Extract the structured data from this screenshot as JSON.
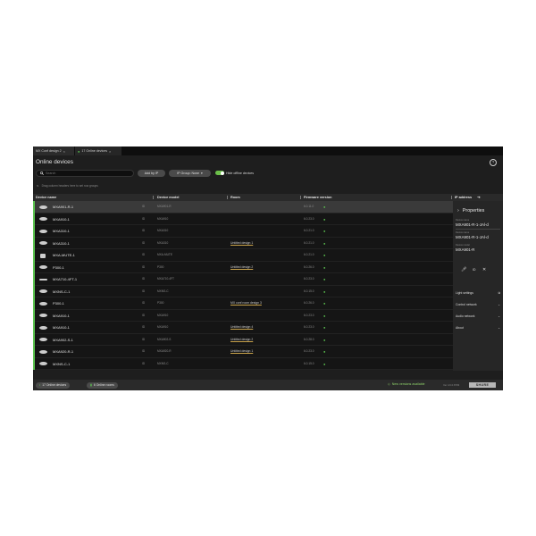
{
  "tabs": [
    {
      "label": "MX Conf design 2",
      "active": false
    },
    {
      "label": "17 Online devices",
      "active": true
    }
  ],
  "header": {
    "title": "Online devices"
  },
  "toolbar": {
    "search_placeholder": "Search",
    "add_by_ip": "Add by IP",
    "group_label": "IP Group: None",
    "hide_offline_label": "Hide offline devices",
    "hide_offline_on": true
  },
  "hint": "Drag column headers here to set row groups",
  "columns": [
    "Device name",
    "Device model",
    "Room",
    "Firmware version",
    "IP address"
  ],
  "rows": [
    {
      "name": "MXA901-R-1",
      "id": "ID",
      "model": "MXA901-R",
      "room": "",
      "fw": "6.0.11.0",
      "icon": "round",
      "selected": true
    },
    {
      "name": "MXA910-1",
      "id": "ID",
      "model": "MXA910",
      "room": "",
      "fw": "6.0.23.0",
      "icon": "round"
    },
    {
      "name": "MXA310-1",
      "id": "ID",
      "model": "MXA310",
      "room": "",
      "fw": "6.0.21.0",
      "icon": "round"
    },
    {
      "name": "MXA310-1",
      "id": "ID",
      "model": "MXA310",
      "room": "Untitled design 1",
      "fw": "6.0.21.0",
      "icon": "round"
    },
    {
      "name": "MXA-MUTE-1",
      "id": "ID",
      "model": "MXA-MUTE",
      "room": "",
      "fw": "6.0.21.0",
      "icon": "sq"
    },
    {
      "name": "P300-1",
      "id": "ID",
      "model": "P300",
      "room": "Untitled design 2",
      "fw": "6.0.26.0",
      "icon": "round"
    },
    {
      "name": "MXA710-4FT-1",
      "id": "ID",
      "model": "MXA710-4FT",
      "room": "",
      "fw": "6.0.23.0",
      "icon": "pill"
    },
    {
      "name": "MXNS-C-1",
      "id": "ID",
      "model": "MXNS-C",
      "room": "",
      "fw": "6.0.15.0",
      "icon": "round"
    },
    {
      "name": "P300-1",
      "id": "ID",
      "model": "P300",
      "room": "MX conf room design 3",
      "fw": "6.0.26.0",
      "icon": "round"
    },
    {
      "name": "MXA910-1",
      "id": "ID",
      "model": "MXA910",
      "room": "",
      "fw": "6.0.23.0",
      "icon": "round"
    },
    {
      "name": "MXA910-1",
      "id": "ID",
      "model": "MXA910",
      "room": "Untitled design 4",
      "fw": "6.0.23.0",
      "icon": "round"
    },
    {
      "name": "MXA902-S-1",
      "id": "ID",
      "model": "MXA902-S",
      "room": "Untitled design 2",
      "fw": "6.0.28.0",
      "icon": "round"
    },
    {
      "name": "MXA920-R-1",
      "id": "ID",
      "model": "MXA920-R",
      "room": "Untitled design 1",
      "fw": "6.0.23.0",
      "icon": "round"
    },
    {
      "name": "MXNS-C-1",
      "id": "ID",
      "model": "MXNS-C",
      "room": "",
      "fw": "6.0.15.0",
      "icon": "round"
    }
  ],
  "properties": {
    "title": "Properties",
    "device_name_label": "Device name",
    "device_name": "MXA901-R-1-JAl-d",
    "device_model_label": "Device model",
    "device_model": "MXA901-R",
    "id_label": "ID",
    "sections": [
      "Light settings",
      "Control network",
      "Audio network",
      "About"
    ]
  },
  "status": {
    "online_devices": "17 Online devices",
    "online_rooms": "6 Online rooms",
    "new_version": "New versions available",
    "version": "Ver 4.6.0.8783",
    "brand": "SHURE"
  },
  "colors": {
    "accent": "#5cc350",
    "background": "#1e1e1e",
    "room_underline": "#c8a24a"
  }
}
